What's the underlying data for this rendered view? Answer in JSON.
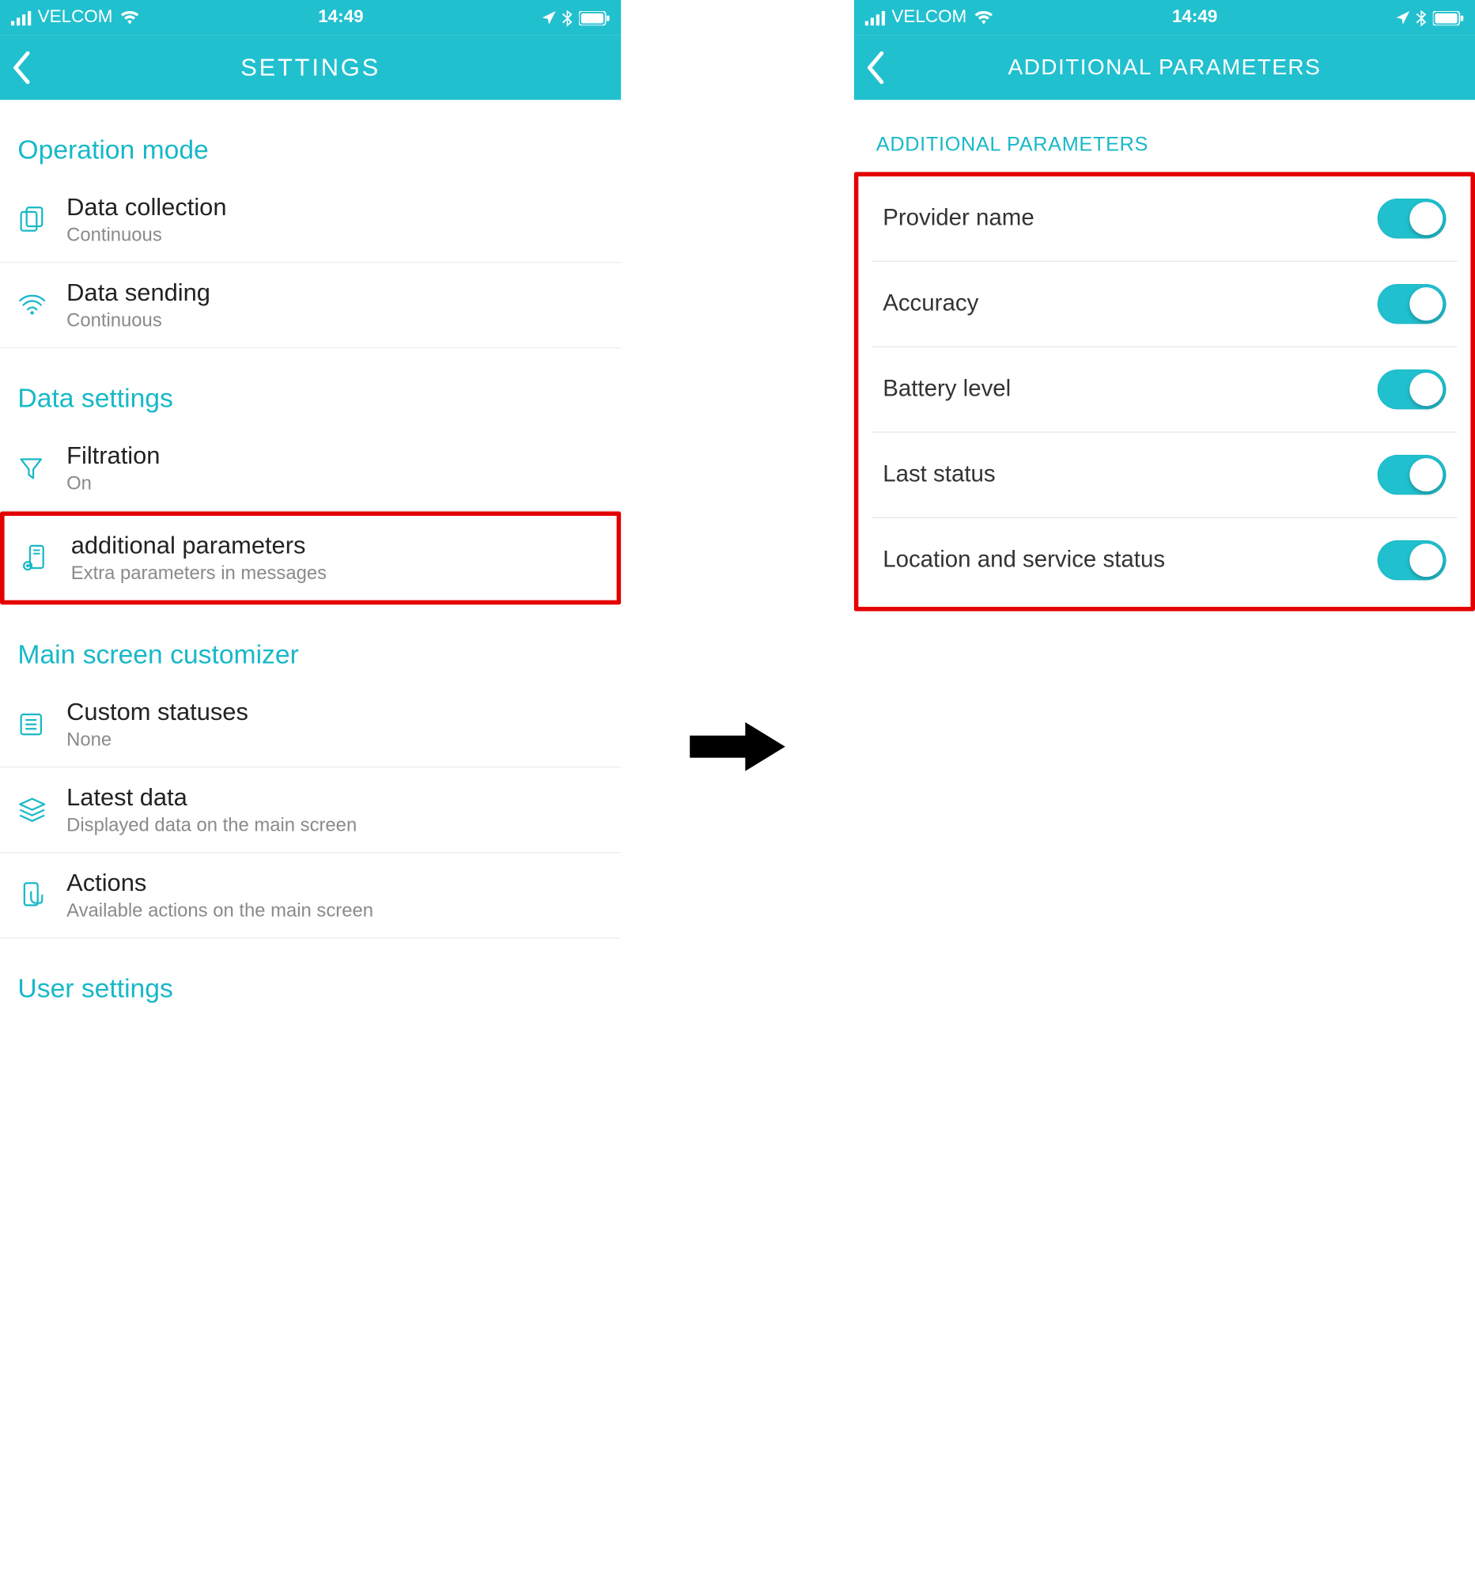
{
  "status": {
    "carrier": "VELCOM",
    "time": "14:49"
  },
  "left": {
    "nav_title": "SETTINGS",
    "sections": {
      "operation_mode": {
        "header": "Operation mode",
        "items": [
          {
            "title": "Data collection",
            "sub": "Continuous",
            "icon": "copy-icon"
          },
          {
            "title": "Data sending",
            "sub": "Continuous",
            "icon": "wifi-icon"
          }
        ]
      },
      "data_settings": {
        "header": "Data settings",
        "items": [
          {
            "title": "Filtration",
            "sub": "On",
            "icon": "funnel-icon"
          },
          {
            "title": "additional parameters",
            "sub": "Extra parameters in messages",
            "icon": "device-icon",
            "highlighted": true
          }
        ]
      },
      "main_screen": {
        "header": "Main screen customizer",
        "items": [
          {
            "title": "Custom statuses",
            "sub": "None",
            "icon": "list-icon"
          },
          {
            "title": "Latest data",
            "sub": "Displayed data on the main screen",
            "icon": "layers-icon"
          },
          {
            "title": "Actions",
            "sub": "Available actions on the main screen",
            "icon": "touch-icon"
          }
        ]
      },
      "user_settings": {
        "header": "User settings"
      }
    }
  },
  "right": {
    "nav_title": "ADDITIONAL PARAMETERS",
    "section_header": "ADDITIONAL PARAMETERS",
    "params": [
      {
        "label": "Provider name",
        "on": true
      },
      {
        "label": "Accuracy",
        "on": true
      },
      {
        "label": "Battery level",
        "on": true
      },
      {
        "label": "Last status",
        "on": true
      },
      {
        "label": "Location and service status",
        "on": true
      }
    ]
  }
}
